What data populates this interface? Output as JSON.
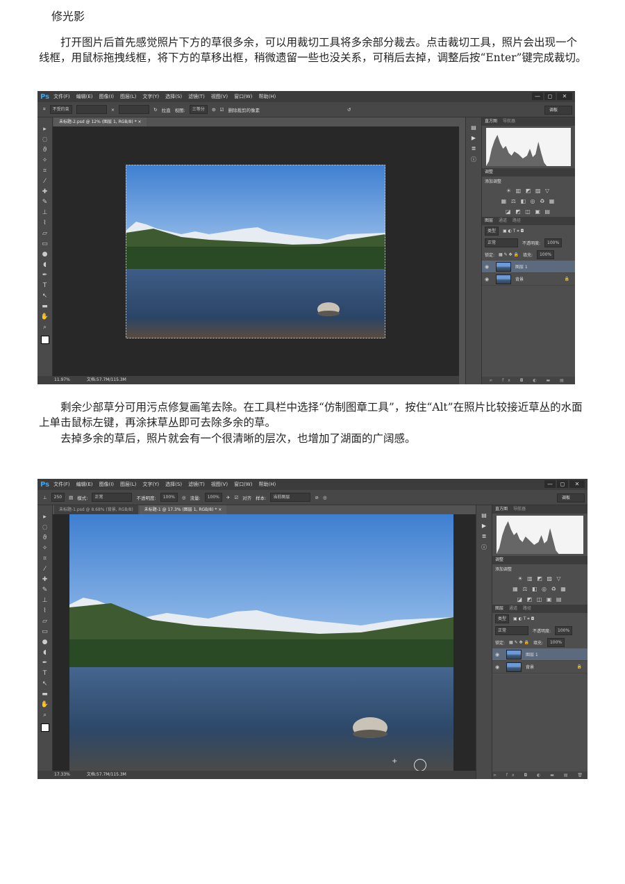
{
  "doc": {
    "title": "修光影",
    "p1": "打开图片后首先感觉照片下方的草很多余，可以用裁切工具将多余部分裁去。点击裁切工具，照片会出现一个线框，用鼠标拖拽线框，将下方的草移出框，稍微遗留一些也没关系，可稍后去掉，调整后按“Enter”键完成裁切。",
    "p2": "剩余少部草分可用污点修复画笔去除。在工具栏中选择“仿制图章工具”，按住“Alt”在照片比较接近草丛的水面上单击鼠标左键，再涂抹草丛即可去除多余的草。",
    "p3": "去掉多余的草后，照片就会有一个很清晰的层次，也增加了湖面的广阔感。"
  },
  "ps": {
    "logo": "Ps",
    "menu": [
      "文件(F)",
      "编辑(E)",
      "图像(I)",
      "图层(L)",
      "文字(Y)",
      "选择(S)",
      "滤镜(T)",
      "视图(V)",
      "窗口(W)",
      "帮助(H)"
    ],
    "win_min": "—",
    "win_max": "◻",
    "win_close": "✕",
    "workspace": "调板",
    "shot1": {
      "opt_ratio": "不受约束",
      "opt_straighten": "拉直",
      "opt_view_label": "视图:",
      "opt_view": "三等分",
      "opt_delete": "删除裁剪的像素",
      "tab": "未标题-2.psd @ 12% (图层 1, RGB/8) * ×",
      "zoom": "11.97%",
      "docsize": "文档:57.7M/115.3M"
    },
    "shot2": {
      "opt_mode_label": "模式:",
      "opt_mode": "正常",
      "opt_opacity_label": "不透明度:",
      "opt_opacity": "100%",
      "opt_flow_label": "流量:",
      "opt_flow": "100%",
      "opt_align": "对齐",
      "opt_sample_label": "样本:",
      "opt_sample": "当前图层",
      "tab1": "未标题-1.psd @ 8.68% (背景, RGB/8)",
      "tab2": "未标题-1 @ 17.3% (图层 1, RGB/8) * ×",
      "zoom": "17.33%",
      "docsize": "文档:57.7M/115.3M"
    },
    "panel": {
      "histogram_tab": "直方图",
      "navigator_tab": "导航器",
      "adjust_tab": "调整",
      "adjust_add": "添加调整",
      "layers_tab": "图层",
      "channels_tab": "通道",
      "paths_tab": "路径",
      "kind": "类型",
      "blend": "正常",
      "opacity_label": "不透明度:",
      "opacity": "100%",
      "lock_label": "锁定:",
      "fill_label": "填充:",
      "fill": "100%",
      "layer1": "图层 1",
      "background": "背景",
      "foot": "∞ fx ◘ ◐ ▬ ▤ 🗑"
    }
  }
}
